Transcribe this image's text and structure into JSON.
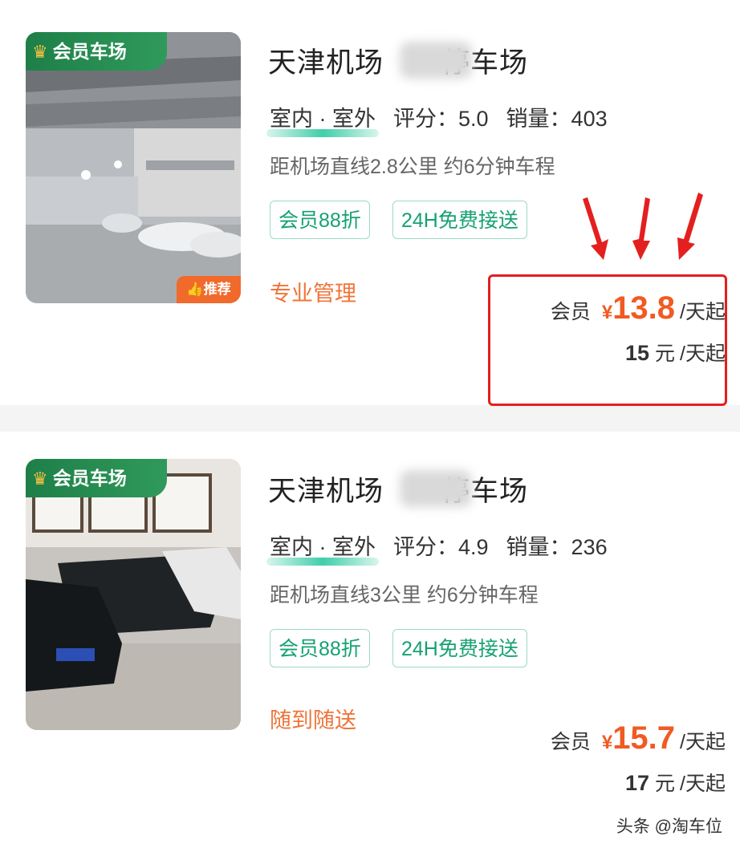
{
  "listings": [
    {
      "member_tag": "会员车场",
      "recommend_tag": "推荐",
      "title_left": "天津机场",
      "title_right": "停车场",
      "io": "室内 · 室外",
      "rating_label": "评分：",
      "rating": "5.0",
      "sales_label": "销量：",
      "sales": "403",
      "distance": "距机场直线2.8公里 约6分钟车程",
      "badges": [
        "会员88折",
        "24H免费接送"
      ],
      "feature": "专业管理",
      "member_label": "会员",
      "yen": "¥",
      "member_price": "13.8",
      "per_day": "/天起",
      "regular_price": "15",
      "regular_unit": "元",
      "regular_per_day": "/天起"
    },
    {
      "member_tag": "会员车场",
      "title_left": "天津机场",
      "title_right": "停车场",
      "io": "室内 · 室外",
      "rating_label": "评分：",
      "rating": "4.9",
      "sales_label": "销量：",
      "sales": "236",
      "distance": "距机场直线3公里 约6分钟车程",
      "badges": [
        "会员88折",
        "24H免费接送"
      ],
      "feature": "随到随送",
      "member_label": "会员",
      "yen": "¥",
      "member_price": "15.7",
      "per_day": "/天起",
      "regular_price": "17",
      "regular_unit": "元",
      "regular_per_day": "/天起"
    }
  ],
  "watermark": "头条 @淘车位",
  "colors": {
    "accent_green": "#17a172",
    "price_orange": "#f15a22",
    "highlight_red": "#e41f1f",
    "member_tag_green": "#1e7f48"
  }
}
